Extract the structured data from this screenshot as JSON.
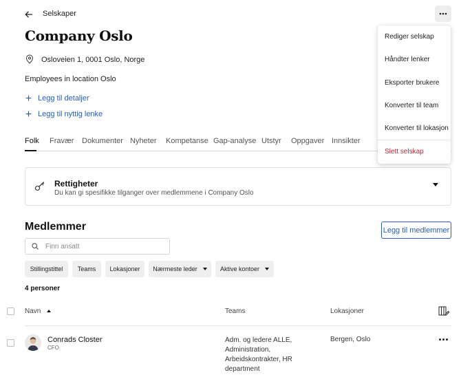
{
  "header": {
    "breadcrumb": "Selskaper",
    "title": "Company Oslo"
  },
  "company": {
    "address": "Osloveien 1, 0001 Oslo, Norge",
    "description": "Employees in location Oslo",
    "add_details": "Legg til detaljer",
    "add_link": "Legg til nyttig lenke"
  },
  "tabs": [
    "Folk",
    "Fravær",
    "Dokumenter",
    "Nyheter",
    "Kompetanse",
    "Gap-analyse",
    "Utstyr",
    "Oppgaver",
    "Innsikter"
  ],
  "rights": {
    "title": "Rettigheter",
    "subtitle": "Du kan gi spesifikke tilganger over medlemmene i Company Oslo"
  },
  "members": {
    "title": "Medlemmer",
    "add_button": "Legg til medlemmer",
    "search_placeholder": "Finn ansatt",
    "filters": [
      "Stillingstittel",
      "Teams",
      "Lokasjoner",
      "Nærmeste leder",
      "Aktive kontoer"
    ],
    "count": "4 personer",
    "columns": {
      "name": "Navn",
      "teams": "Teams",
      "locations": "Lokasjoner"
    },
    "rows": [
      {
        "name": "Conrads Closter",
        "role": "CFO",
        "teams": [
          "Adm. og ledere ALLE,",
          "Administration,",
          "Arbeidskontrakter, HR",
          "department"
        ],
        "locations": "Bergen, Oslo"
      }
    ]
  },
  "menu": {
    "items": [
      "Rediger selskap",
      "Håndter lenker",
      "Eksporter brukere",
      "Konverter til team",
      "Konverter til lokasjon"
    ],
    "danger": "Slett selskap"
  },
  "colors": {
    "accent": "#2a5db0",
    "danger": "#b4283a"
  }
}
